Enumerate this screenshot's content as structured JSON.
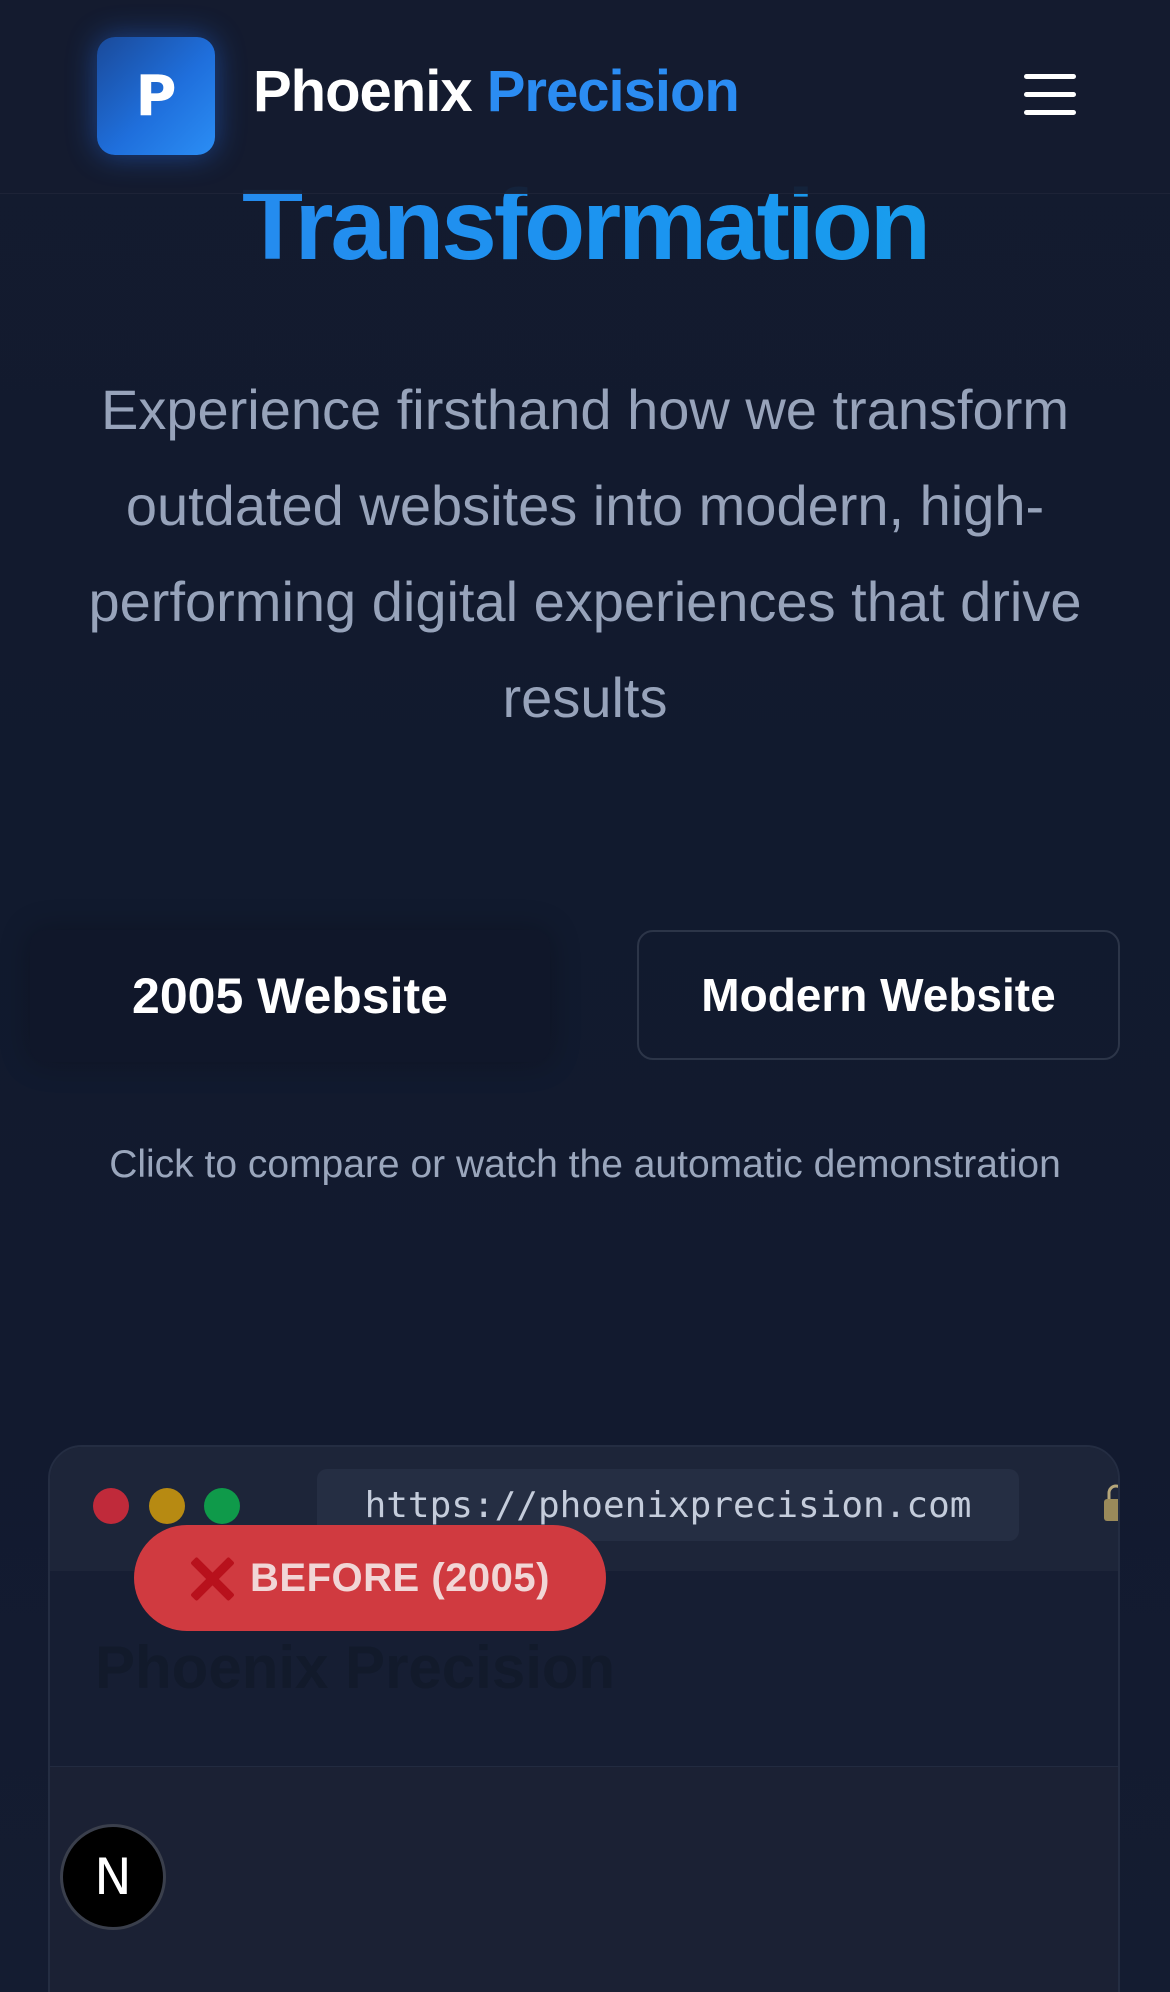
{
  "header": {
    "logo_letter": "P",
    "brand_main": "Phoenix",
    "brand_accent": "Precision",
    "menu_icon": "hamburger-menu-icon"
  },
  "hero": {
    "title": "Transformation",
    "subtitle": "Experience firsthand how we transform outdated websites into modern, high-performing digital experiences that drive results"
  },
  "toggle": {
    "old_label": "2005 Website",
    "new_label": "Modern Website",
    "hint": "Click to compare or watch the automatic demonstration"
  },
  "browser": {
    "url": "https://phoenixprecision.com",
    "site_title": "Phoenix Precision",
    "badge_label": "BEFORE (2005)",
    "badge_icon": "x-icon"
  },
  "dev_badge": {
    "letter": "N"
  },
  "colors": {
    "accent": "#2b8cf2",
    "background": "#121a2e",
    "badge_red": "#d03a40"
  }
}
